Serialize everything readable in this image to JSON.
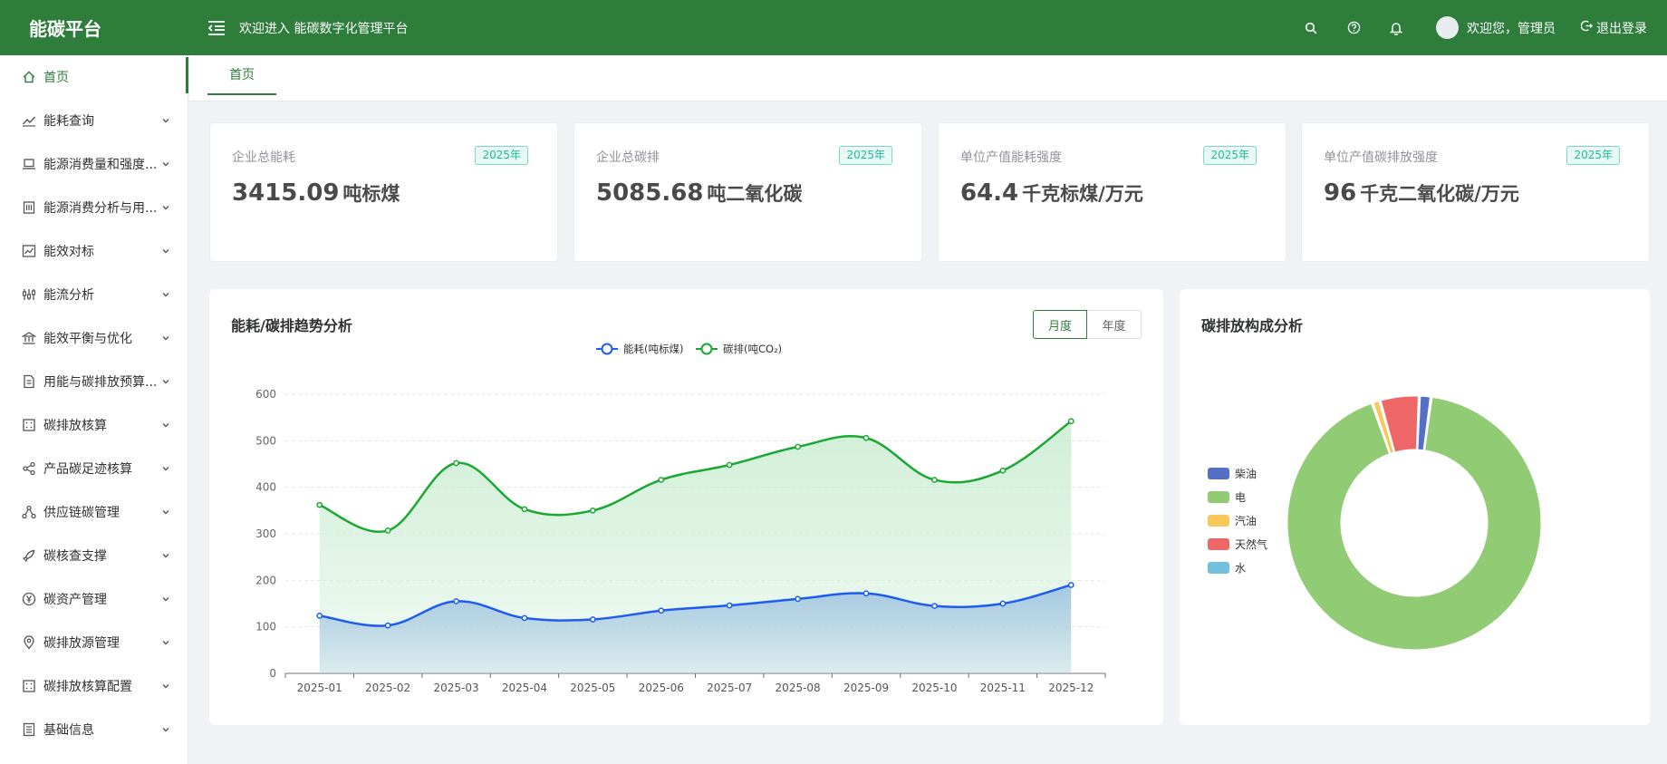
{
  "header": {
    "logo": "能碳平台",
    "welcome": "欢迎进入 能碳数字化管理平台",
    "user": "欢迎您，管理员",
    "logout": "退出登录"
  },
  "sidebar": {
    "items": [
      {
        "label": "首页",
        "icon": "home-icon"
      },
      {
        "label": "能耗查询",
        "icon": "trend-line-icon"
      },
      {
        "label": "能源消费量和强度...",
        "icon": "laptop-icon"
      },
      {
        "label": "能源消费分析与用...",
        "icon": "building-icon"
      },
      {
        "label": "能效对标",
        "icon": "chart-icon"
      },
      {
        "label": "能流分析",
        "icon": "flow-icon"
      },
      {
        "label": "能效平衡与优化",
        "icon": "bank-icon"
      },
      {
        "label": "用能与碳排放预算...",
        "icon": "document-icon"
      },
      {
        "label": "碳排放核算",
        "icon": "calculator-icon"
      },
      {
        "label": "产品碳足迹核算",
        "icon": "share-icon"
      },
      {
        "label": "供应链碳管理",
        "icon": "network-icon"
      },
      {
        "label": "碳核查支撑",
        "icon": "rocket-icon"
      },
      {
        "label": "碳资产管理",
        "icon": "yen-icon"
      },
      {
        "label": "碳排放源管理",
        "icon": "location-icon"
      },
      {
        "label": "碳排放核算配置",
        "icon": "calculator-icon"
      },
      {
        "label": "基础信息",
        "icon": "list-icon"
      }
    ]
  },
  "tabs": [
    "首页"
  ],
  "cards": [
    {
      "label": "企业总能耗",
      "badge": "2025年",
      "value": "3415.09",
      "unit": "吨标煤"
    },
    {
      "label": "企业总碳排",
      "badge": "2025年",
      "value": "5085.68",
      "unit": "吨二氧化碳"
    },
    {
      "label": "单位产值能耗强度",
      "badge": "2025年",
      "value": "64.4",
      "unit": "千克标煤/万元"
    },
    {
      "label": "单位产值碳排放强度",
      "badge": "2025年",
      "value": "96",
      "unit": "千克二氧化碳/万元"
    }
  ],
  "trend": {
    "title": "能耗/碳排趋势分析",
    "toggle": [
      "月度",
      "年度"
    ]
  },
  "composition": {
    "title": "碳排放构成分析"
  },
  "chart_data": [
    {
      "type": "area",
      "title": "能耗/碳排趋势分析",
      "x": [
        "2025-01",
        "2025-02",
        "2025-03",
        "2025-04",
        "2025-05",
        "2025-06",
        "2025-07",
        "2025-08",
        "2025-09",
        "2025-10",
        "2025-11",
        "2025-12"
      ],
      "ylim": [
        0,
        600
      ],
      "yticks": [
        0,
        100,
        200,
        300,
        400,
        500,
        600
      ],
      "grid": true,
      "legend_position": "top-center",
      "series": [
        {
          "name": "能耗(吨标煤)",
          "color": "#1e5cf0",
          "fill": "#9ec3df",
          "values": [
            124,
            103,
            155,
            119,
            116,
            135,
            146,
            160,
            172,
            145,
            150,
            190
          ]
        },
        {
          "name": "碳排(吨CO₂)",
          "color": "#19a832",
          "fill": "#c8ecd0",
          "values": [
            362,
            307,
            452,
            353,
            350,
            416,
            448,
            487,
            506,
            416,
            436,
            542
          ]
        }
      ]
    },
    {
      "type": "pie",
      "title": "碳排放构成分析",
      "donut": true,
      "legend_position": "left",
      "slices": [
        {
          "name": "柴油",
          "value": 1.5,
          "color": "#5470c6"
        },
        {
          "name": "电",
          "value": 92.5,
          "color": "#91cc75"
        },
        {
          "name": "汽油",
          "value": 1,
          "color": "#fac858"
        },
        {
          "name": "天然气",
          "value": 5,
          "color": "#ee6666"
        },
        {
          "name": "水",
          "value": 0,
          "color": "#73c0de"
        }
      ]
    }
  ]
}
